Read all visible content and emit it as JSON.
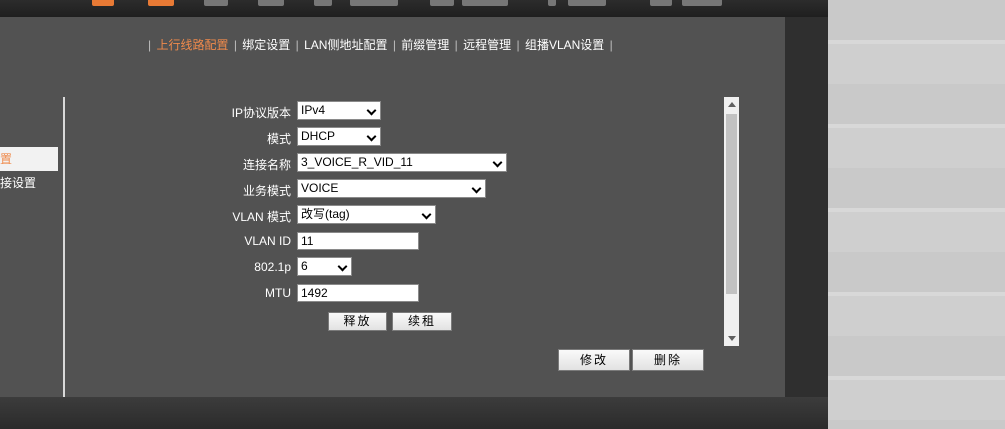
{
  "subnav": {
    "items": [
      "上行线路配置",
      "绑定设置",
      "LAN侧地址配置",
      "前缀管理",
      "远程管理",
      "组播VLAN设置"
    ],
    "separator": "|",
    "active_color": "#f08a4b"
  },
  "sidebar": {
    "items": [
      {
        "label": "置",
        "active": true
      },
      {
        "label": "接设置",
        "active": false
      }
    ]
  },
  "form": {
    "ip_version": {
      "label": "IP协议版本",
      "value": "IPv4"
    },
    "mode": {
      "label": "模式",
      "value": "DHCP"
    },
    "conn_name": {
      "label": "连接名称",
      "value": "3_VOICE_R_VID_11"
    },
    "service_mode": {
      "label": "业务模式",
      "value": "VOICE"
    },
    "vlan_mode": {
      "label": "VLAN 模式",
      "value": "改写(tag)"
    },
    "vlan_id": {
      "label": "VLAN ID",
      "value": "11"
    },
    "p8021": {
      "label": "802.1p",
      "value": "6"
    },
    "mtu": {
      "label": "MTU",
      "value": "1492"
    }
  },
  "buttons": {
    "release": "释放",
    "renew": "续租",
    "modify": "修改",
    "delete": "删除"
  }
}
